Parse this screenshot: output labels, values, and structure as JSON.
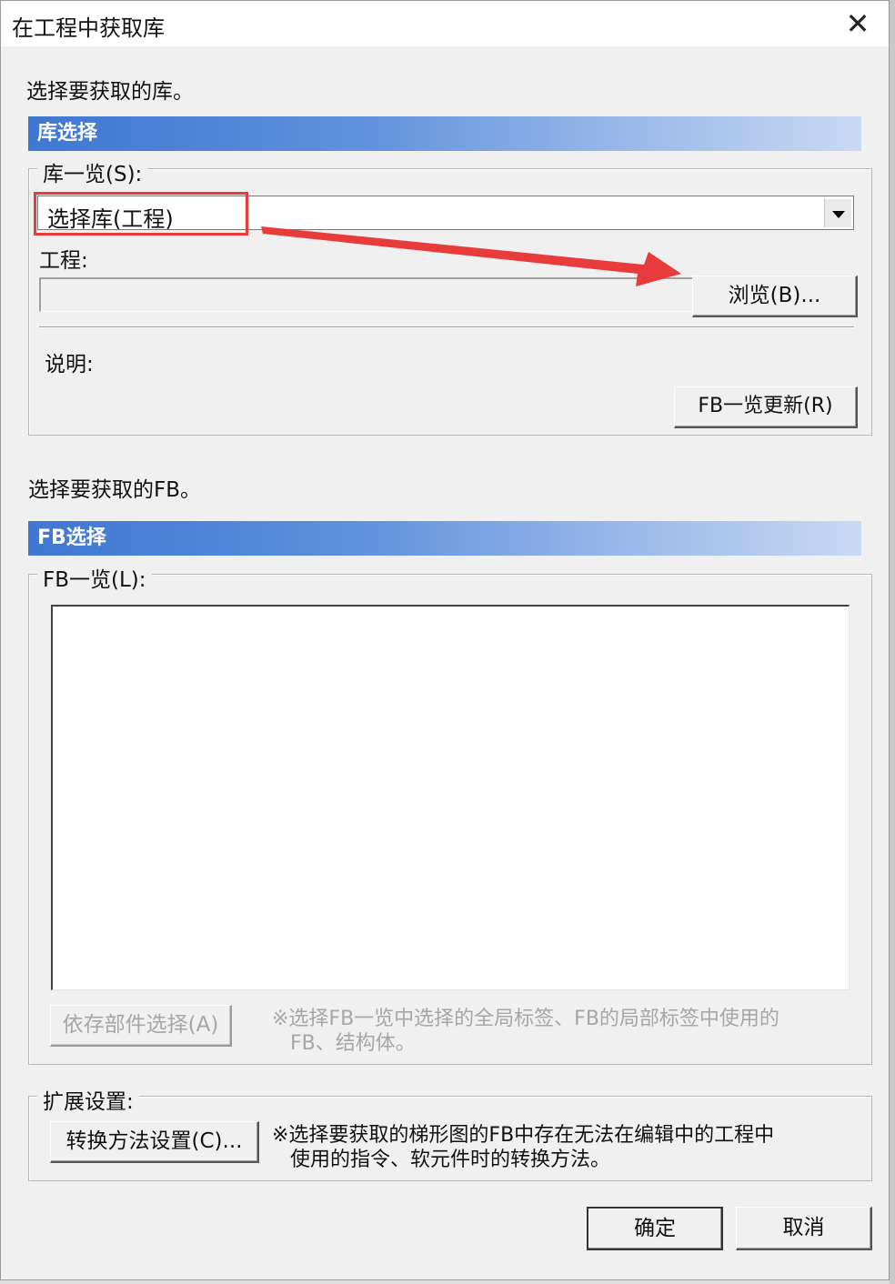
{
  "window": {
    "title": "在工程中获取库",
    "close_symbol": "✕"
  },
  "library": {
    "instruction": "选择要获取的库。",
    "section_header": "库选择",
    "list_label": "库一览(S):",
    "selected_value": "选择库(工程)",
    "project_label": "工程:",
    "project_value": "",
    "browse_button": "浏览(B)...",
    "description_label": "说明:",
    "refresh_button": "FB一览更新(R)"
  },
  "fb": {
    "instruction": "选择要获取的FB。",
    "section_header": "FB选择",
    "list_label": "FB一览(L):",
    "items": [],
    "dependency_button": "依存部件选择(A)",
    "dependency_note_line1": "※选择FB一览中选择的全局标签、FB的局部标签中使用的",
    "dependency_note_line2": "FB、结构体。"
  },
  "extension": {
    "label": "扩展设置:",
    "conversion_button": "转换方法设置(C)...",
    "note_line1": "※选择要获取的梯形图的FB中存在无法在编辑中的工程中",
    "note_line2": "使用的指令、软元件时的转换方法。"
  },
  "footer": {
    "ok_button": "确定",
    "cancel_button": "取消"
  },
  "colors": {
    "annotation": "#e83c3c",
    "header_gradient_start": "#3f77d2",
    "header_gradient_end": "#c8d9f2"
  },
  "icons": {
    "close": "close-icon",
    "dropdown": "chevron-down-icon",
    "annotation_arrow": "arrow-icon"
  }
}
